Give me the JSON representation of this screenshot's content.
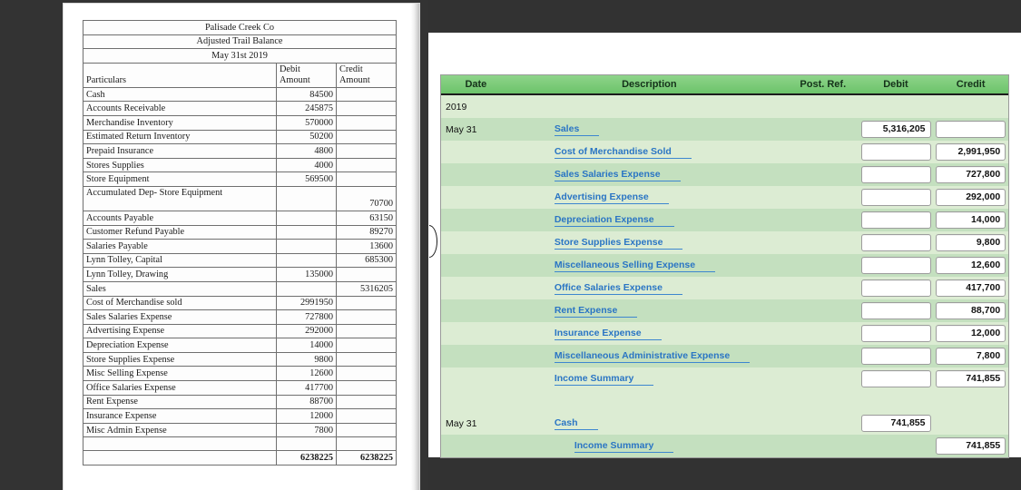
{
  "document": {
    "company": "Palisade Creek Co",
    "statement_title": "Adjusted Trail Balance",
    "date": "May 31st 2019",
    "columns": {
      "particulars": "Particulars",
      "debit_line1": "Debit",
      "debit_line2": "Amount",
      "credit_line1": "Credit",
      "credit_line2": "Amount"
    },
    "rows": [
      {
        "particulars": "Cash",
        "debit": "84500",
        "credit": ""
      },
      {
        "particulars": "Accounts Receivable",
        "debit": "245875",
        "credit": ""
      },
      {
        "particulars": "Merchandise Inventory",
        "debit": "570000",
        "credit": ""
      },
      {
        "particulars": "Estimated Return Inventory",
        "debit": "50200",
        "credit": ""
      },
      {
        "particulars": "Prepaid Insurance",
        "debit": "4800",
        "credit": ""
      },
      {
        "particulars": "Stores Supplies",
        "debit": "4000",
        "credit": ""
      },
      {
        "particulars": "Store Equipment",
        "debit": "569500",
        "credit": ""
      },
      {
        "particulars": "Accumulated Dep- Store Equipment",
        "debit": "",
        "credit": "70700",
        "twoline": true
      },
      {
        "particulars": "Accounts Payable",
        "debit": "",
        "credit": "63150"
      },
      {
        "particulars": "Customer Refund Payable",
        "debit": "",
        "credit": "89270"
      },
      {
        "particulars": "Salaries Payable",
        "debit": "",
        "credit": "13600"
      },
      {
        "particulars": "Lynn Tolley, Capital",
        "debit": "",
        "credit": "685300"
      },
      {
        "particulars": "Lynn Tolley, Drawing",
        "debit": "135000",
        "credit": ""
      },
      {
        "particulars": "Sales",
        "debit": "",
        "credit": "5316205"
      },
      {
        "particulars": "Cost of Merchandise sold",
        "debit": "2991950",
        "credit": ""
      },
      {
        "particulars": "Sales Salaries Expense",
        "debit": "727800",
        "credit": ""
      },
      {
        "particulars": "Advertising Expense",
        "debit": "292000",
        "credit": ""
      },
      {
        "particulars": "Depreciation Expense",
        "debit": "14000",
        "credit": ""
      },
      {
        "particulars": "Store Supplies Expense",
        "debit": "9800",
        "credit": ""
      },
      {
        "particulars": "Misc Selling Expense",
        "debit": "12600",
        "credit": ""
      },
      {
        "particulars": "Office Salaries Expense",
        "debit": "417700",
        "credit": ""
      },
      {
        "particulars": "Rent Expense",
        "debit": "88700",
        "credit": ""
      },
      {
        "particulars": "Insurance Expense",
        "debit": "12000",
        "credit": ""
      },
      {
        "particulars": "Misc Admin Expense",
        "debit": "7800",
        "credit": ""
      }
    ],
    "totals": {
      "particulars": "",
      "debit": "6238225",
      "credit": "6238225"
    }
  },
  "journal": {
    "headers": {
      "date": "Date",
      "description": "Description",
      "post_ref": "Post. Ref.",
      "debit": "Debit",
      "credit": "Credit"
    },
    "colors": {
      "header_green": "#6cc36a",
      "row_dark": "#c4e0bf",
      "row_light": "#dcecd3",
      "link_blue": "#2a75c4"
    },
    "year": "2019",
    "rows": [
      {
        "kind": "year",
        "date": "2019",
        "account": "",
        "indent": 0,
        "debit": "",
        "credit": "",
        "debit_box": false,
        "credit_box": false
      },
      {
        "kind": "entry",
        "date": "May 31",
        "account": "Sales",
        "indent": 0,
        "debit": "5,316,205",
        "credit": "",
        "debit_box": true,
        "credit_box": true
      },
      {
        "kind": "entry",
        "date": "",
        "account": "Cost of Merchandise Sold",
        "indent": 0,
        "debit": "",
        "credit": "2,991,950",
        "debit_box": true,
        "credit_box": true
      },
      {
        "kind": "entry",
        "date": "",
        "account": "Sales Salaries Expense",
        "indent": 0,
        "debit": "",
        "credit": "727,800",
        "debit_box": true,
        "credit_box": true
      },
      {
        "kind": "entry",
        "date": "",
        "account": "Advertising Expense",
        "indent": 0,
        "debit": "",
        "credit": "292,000",
        "debit_box": true,
        "credit_box": true
      },
      {
        "kind": "entry",
        "date": "",
        "account": "Depreciation Expense",
        "indent": 0,
        "debit": "",
        "credit": "14,000",
        "debit_box": true,
        "credit_box": true
      },
      {
        "kind": "entry",
        "date": "",
        "account": "Store Supplies Expense",
        "indent": 0,
        "debit": "",
        "credit": "9,800",
        "debit_box": true,
        "credit_box": true
      },
      {
        "kind": "entry",
        "date": "",
        "account": "Miscellaneous Selling Expense",
        "indent": 0,
        "debit": "",
        "credit": "12,600",
        "debit_box": true,
        "credit_box": true
      },
      {
        "kind": "entry",
        "date": "",
        "account": "Office Salaries Expense",
        "indent": 0,
        "debit": "",
        "credit": "417,700",
        "debit_box": true,
        "credit_box": true
      },
      {
        "kind": "entry",
        "date": "",
        "account": "Rent Expense",
        "indent": 0,
        "debit": "",
        "credit": "88,700",
        "debit_box": true,
        "credit_box": true
      },
      {
        "kind": "entry",
        "date": "",
        "account": "Insurance Expense",
        "indent": 0,
        "debit": "",
        "credit": "12,000",
        "debit_box": true,
        "credit_box": true
      },
      {
        "kind": "entry",
        "date": "",
        "account": "Miscellaneous Administrative Expense",
        "indent": 0,
        "debit": "",
        "credit": "7,800",
        "debit_box": true,
        "credit_box": true
      },
      {
        "kind": "entry",
        "date": "",
        "account": "Income Summary",
        "indent": 0,
        "debit": "",
        "credit": "741,855",
        "debit_box": true,
        "credit_box": true
      },
      {
        "kind": "blank",
        "date": "",
        "account": "",
        "indent": 0,
        "debit": "",
        "credit": "",
        "debit_box": false,
        "credit_box": false
      },
      {
        "kind": "entry",
        "date": "May 31",
        "account": "Cash",
        "indent": 0,
        "debit": "741,855",
        "credit": "",
        "debit_box": true,
        "credit_box": false
      },
      {
        "kind": "entry",
        "date": "",
        "account": "Income Summary",
        "indent": 1,
        "debit": "",
        "credit": "741,855",
        "debit_box": false,
        "credit_box": true
      }
    ]
  }
}
